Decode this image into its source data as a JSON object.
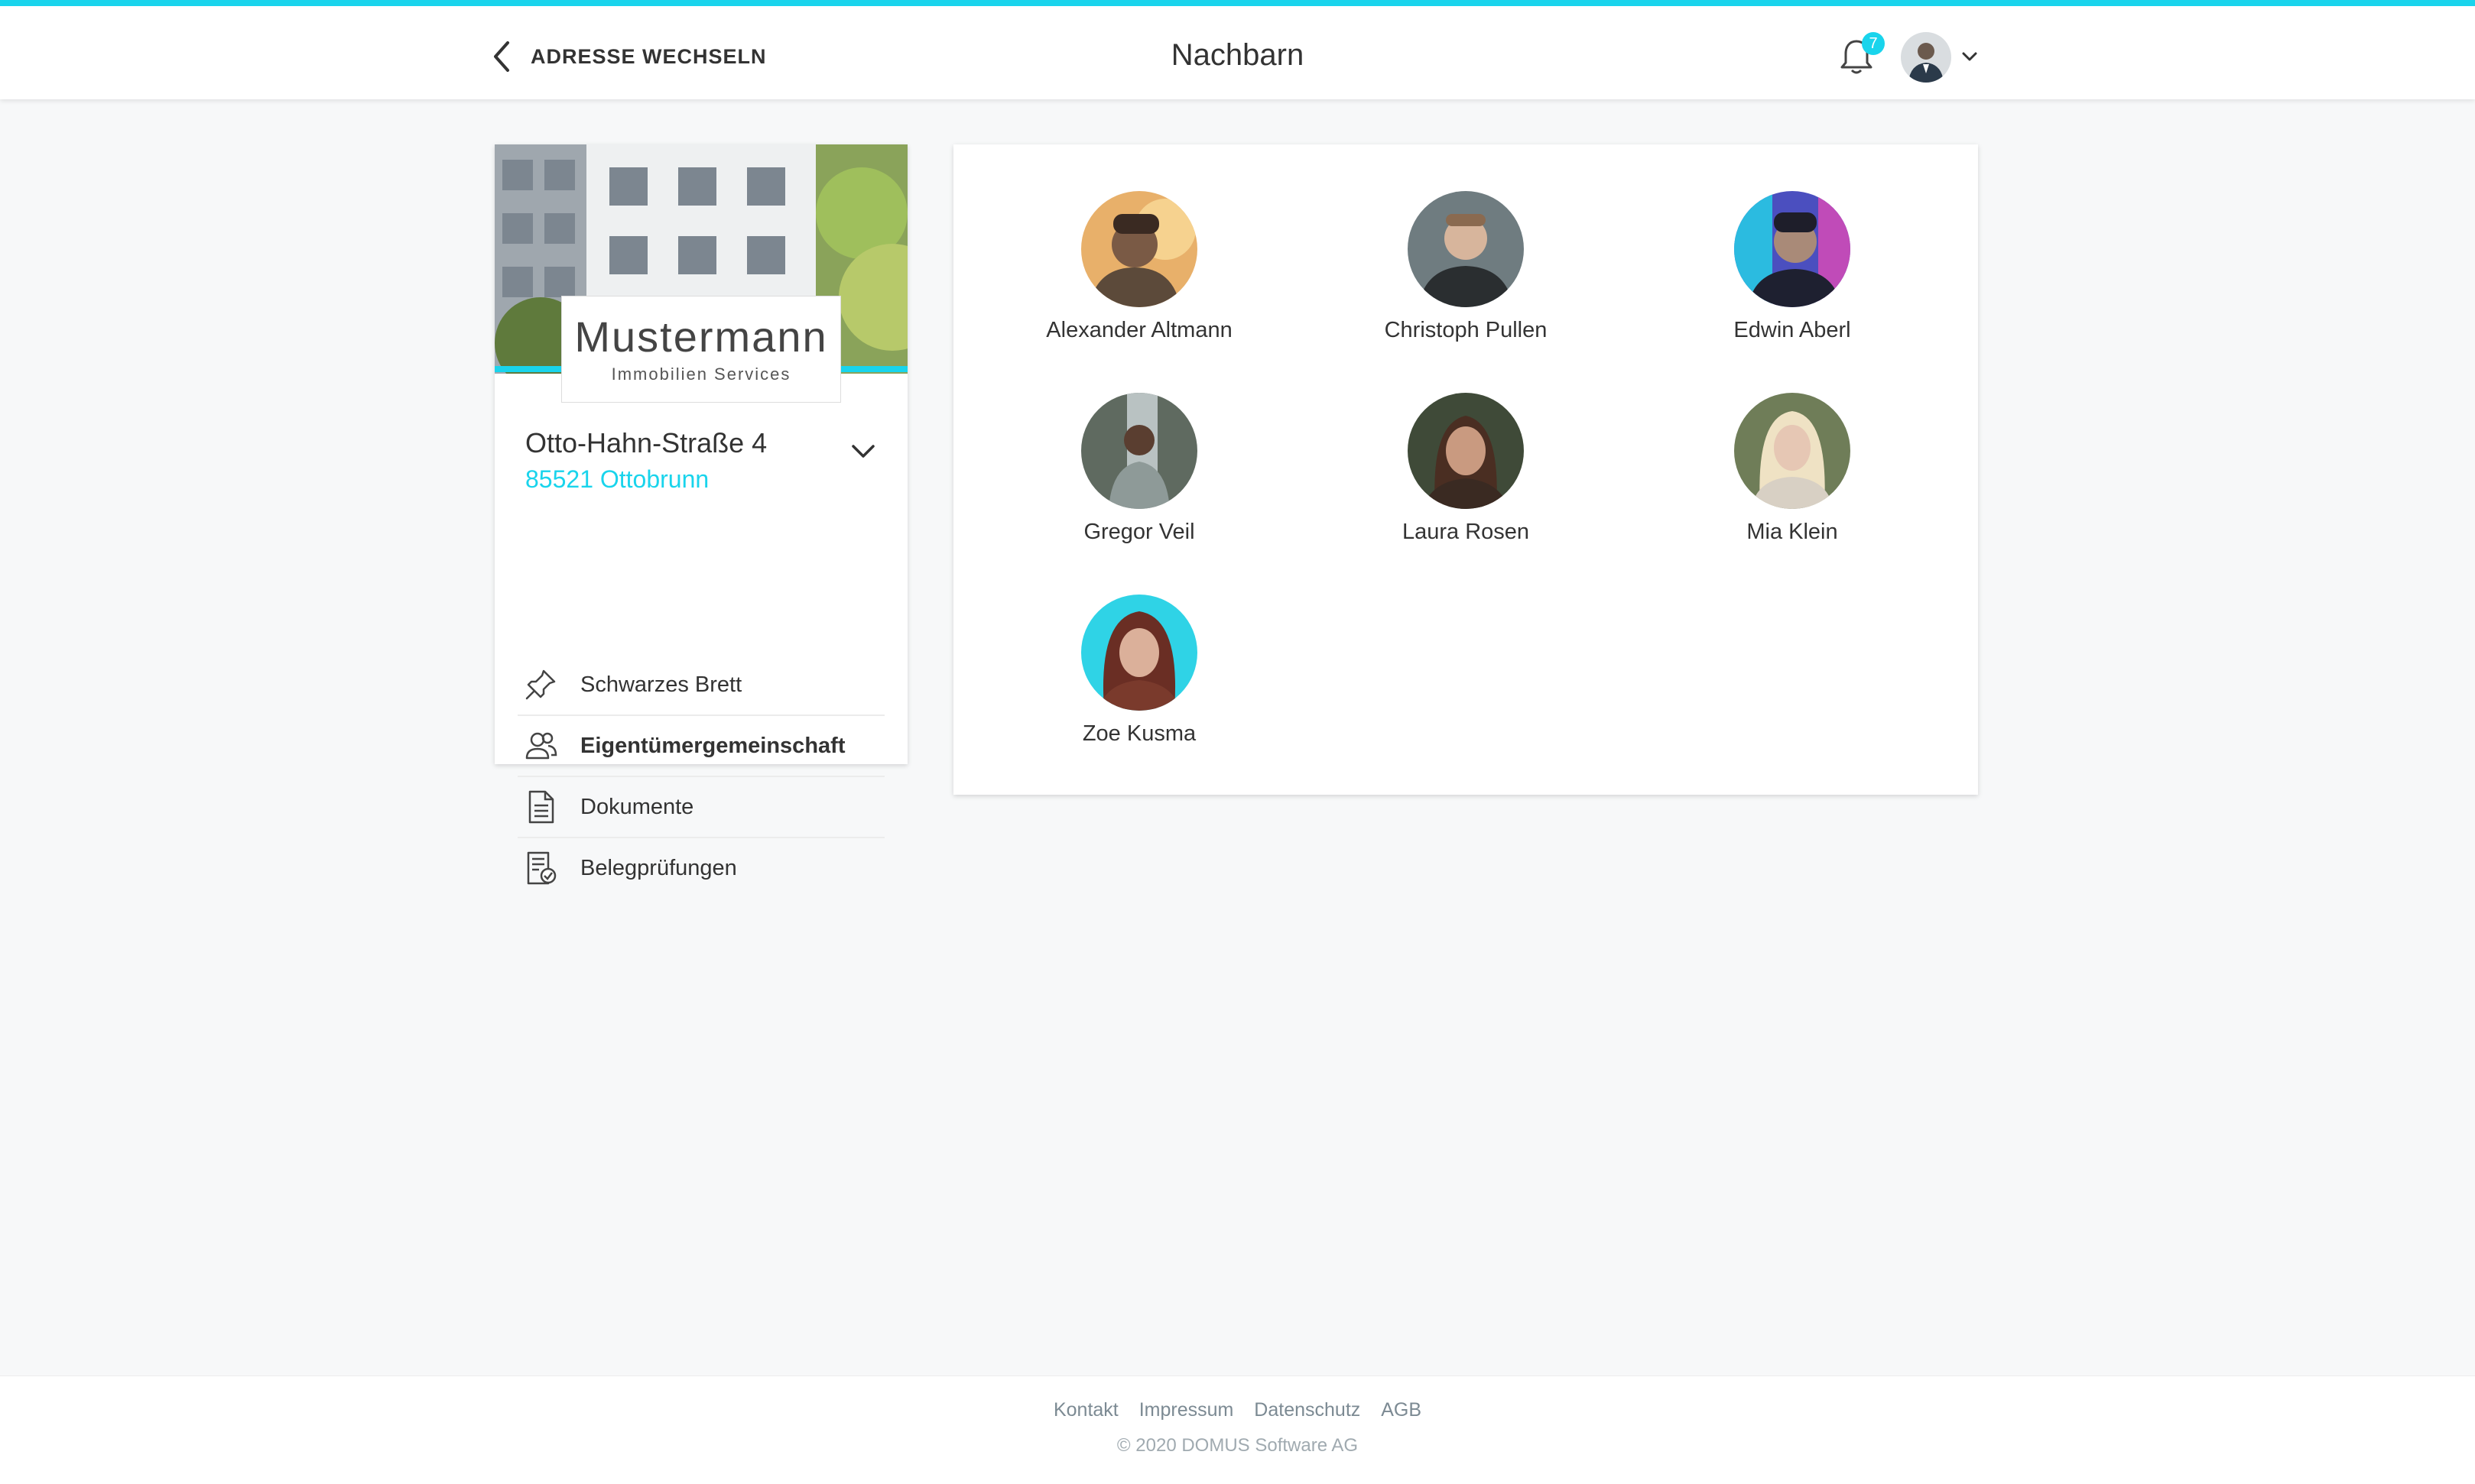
{
  "header": {
    "back_label": "ADRESSE WECHSELN",
    "title": "Nachbarn",
    "notification_count": "7",
    "accent_color": "#19d4ec"
  },
  "sidebar": {
    "brand_name": "Mustermann",
    "brand_sub": "Immobilien Services",
    "street": "Otto-Hahn-Straße 4",
    "city": "85521 Ottobrunn",
    "items": [
      {
        "label": "Schwarzes Brett",
        "icon": "pin-icon"
      },
      {
        "label": "Eigentümergemeinschaft",
        "icon": "group-icon",
        "active": true
      },
      {
        "label": "Dokumente",
        "icon": "document-icon"
      },
      {
        "label": "Belegprüfungen",
        "icon": "receipt-check-icon"
      }
    ]
  },
  "neighbors": [
    {
      "name": "Alexander Altmann"
    },
    {
      "name": "Christoph Pullen"
    },
    {
      "name": "Edwin Aberl"
    },
    {
      "name": "Gregor Veil"
    },
    {
      "name": "Laura Rosen"
    },
    {
      "name": "Mia Klein"
    },
    {
      "name": "Zoe Kusma"
    }
  ],
  "footer": {
    "links": [
      "Kontakt",
      "Impressum",
      "Datenschutz",
      "AGB"
    ],
    "copyright": "© 2020  DOMUS Software AG"
  }
}
